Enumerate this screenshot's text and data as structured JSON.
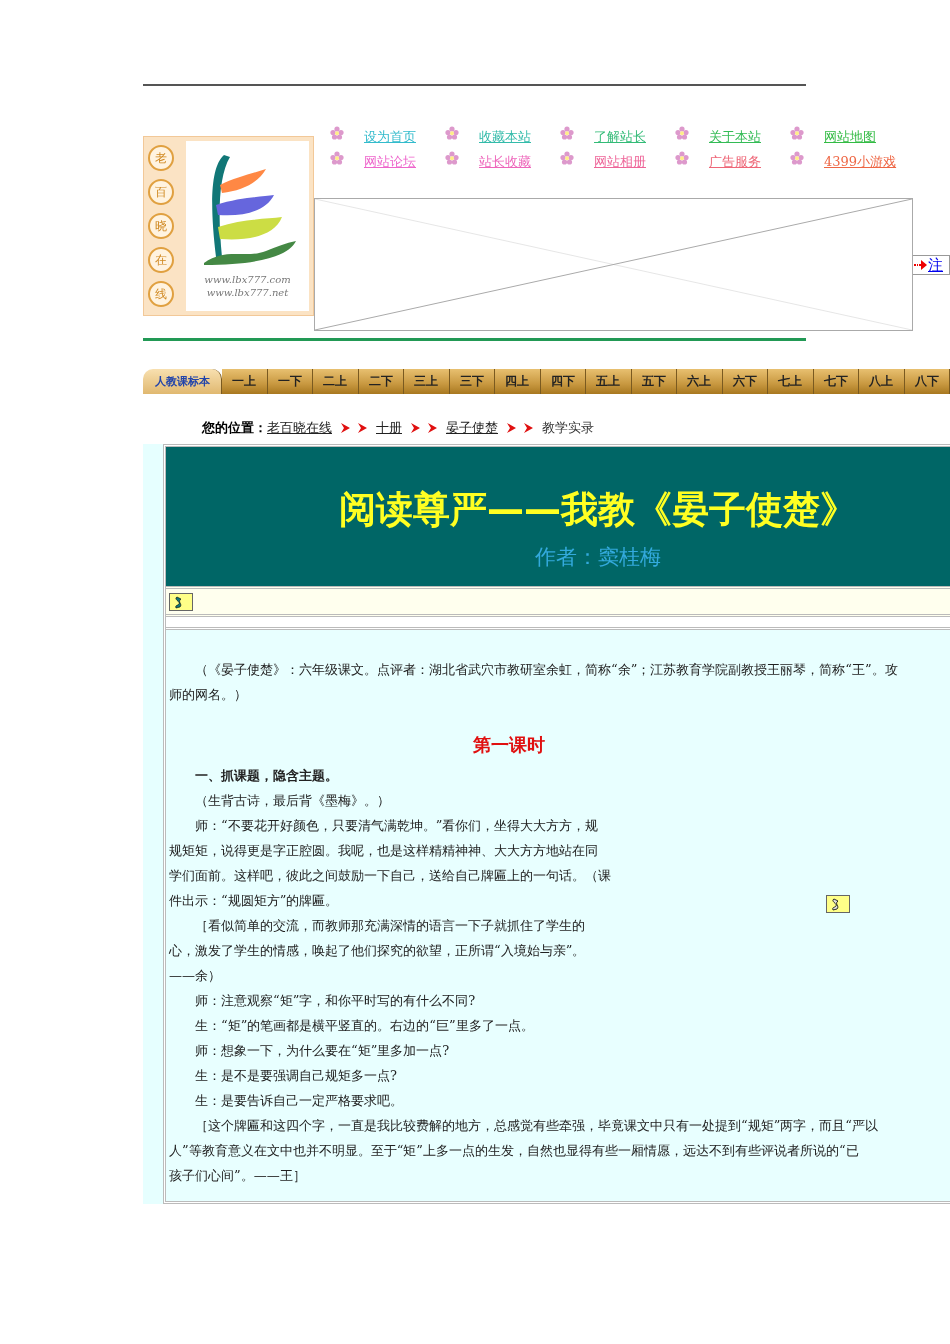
{
  "logo": {
    "vertical": [
      "老",
      "百",
      "晓",
      "在",
      "线"
    ],
    "urls": [
      "www.lbx777.com",
      "www.lbx777.net"
    ]
  },
  "quick_links": [
    {
      "label": "设为首页",
      "color": "#33bbcc"
    },
    {
      "label": "收藏本站",
      "color": "#33bbaa"
    },
    {
      "label": "了解站长",
      "color": "#33bb77"
    },
    {
      "label": "关于本站",
      "color": "#33bb55"
    },
    {
      "label": "网站地图",
      "color": "#33bb44"
    },
    {
      "label": "网站论坛",
      "color": "#ee66cc"
    },
    {
      "label": "站长收藏",
      "color": "#ee66bb"
    },
    {
      "label": "网站相册",
      "color": "#ee6699"
    },
    {
      "label": "广告服务",
      "color": "#ee6677"
    },
    {
      "label": "4399小游戏",
      "color": "#ee6644"
    }
  ],
  "register_link": {
    "label": "注"
  },
  "grade_nav": {
    "brand": "人教课标本",
    "tabs": [
      "一上",
      "一下",
      "二上",
      "二下",
      "三上",
      "三下",
      "四上",
      "四下",
      "五上",
      "五下",
      "六上",
      "六下",
      "七上",
      "七下",
      "八上",
      "八下"
    ]
  },
  "breadcrumb": {
    "label": "您的位置：",
    "items": [
      {
        "text": "老百晓在线",
        "link": true
      },
      {
        "text": "十册",
        "link": true
      },
      {
        "text": "晏子使楚",
        "link": true
      },
      {
        "text": "教学实录",
        "link": false
      }
    ]
  },
  "article": {
    "title": "阅读尊严——我教《晏子使楚》",
    "author": "作者：窦桂梅",
    "intro": [
      "（《晏子使楚》：六年级课文。点评者：湖北省武穴市教研室余虹，简称“余”；江苏教育学院副教授王丽琴，简称“王”。攻",
      "师的网名。）"
    ],
    "section_title": "第一课时",
    "blocks": [
      {
        "kind": "heading",
        "lines": [
          "一、抓课题，隐含主题。"
        ]
      },
      {
        "kind": "para",
        "lines": [
          "（生背古诗，最后背《墨梅》。）"
        ]
      },
      {
        "kind": "para",
        "lines": [
          "师：“不要花开好颜色，只要清气满乾坤。”看你们，坐得大大方方，规",
          "规矩矩，说得更是字正腔圆。我呢，也是这样精精神神、大大方方地站在同",
          "学们面前。这样吧，彼此之间鼓励一下自己，送给自己牌匾上的一句话。（课",
          "件出示：“规圆矩方”的牌匾。"
        ]
      },
      {
        "kind": "para",
        "lines": [
          "［看似简单的交流，而教师那充满深情的语言一下子就抓住了学生的",
          "心，激发了学生的情感，唤起了他们探究的欲望，正所谓“入境始与亲”。",
          "——余）"
        ]
      },
      {
        "kind": "para",
        "lines": [
          "师：注意观察“矩”字，和你平时写的有什么不同?"
        ]
      },
      {
        "kind": "para",
        "lines": [
          "生：“矩”的笔画都是横平竖直的。右边的“巨”里多了一点。"
        ]
      },
      {
        "kind": "para",
        "lines": [
          "师：想象一下，为什么要在“矩”里多加一点?"
        ]
      },
      {
        "kind": "para",
        "lines": [
          "生：是不是要强调自己规矩多一点?"
        ]
      },
      {
        "kind": "para",
        "lines": [
          "生：是要告诉自己一定严格要求吧。"
        ]
      },
      {
        "kind": "para",
        "lines": [
          "［这个牌匾和这四个字，一直是我比较费解的地方，总感觉有些牵强，毕竟课文中只有一处提到“规矩”两字，而且“严以",
          "人”等教育意义在文中也并不明显。至于“矩”上多一点的生发，自然也显得有些一厢情愿，远达不到有些评说者所说的“已",
          "孩子们心间”。——王］"
        ]
      }
    ]
  }
}
